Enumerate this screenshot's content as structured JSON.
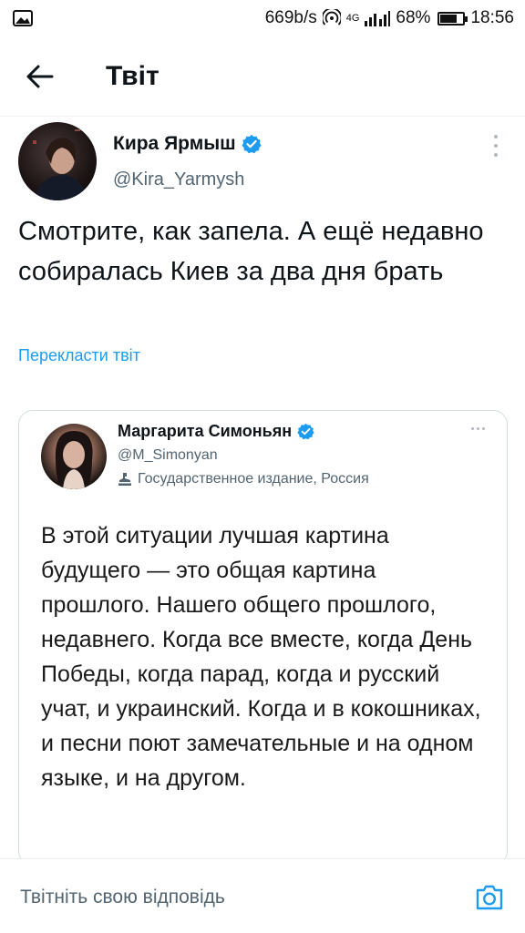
{
  "status_bar": {
    "speed": "669b/s",
    "network": "4G",
    "battery": "68%",
    "battery_level": 0.68,
    "time": "18:56",
    "icons": [
      "image-icon",
      "hotspot-icon",
      "signal-icon",
      "battery-icon"
    ]
  },
  "header": {
    "back_icon": "arrow-left-icon",
    "title": "Твіт"
  },
  "tweet": {
    "author_name": "Кира Ярмыш",
    "author_handle": "@Kira_Yarmysh",
    "verified_icon": "verified-badge-icon",
    "text": "Смотрите, как запела. А ещё недавно собиралась Киев за два дня брать",
    "translate": "Перекласти твіт"
  },
  "quoted_tweet": {
    "author_name": "Маргарита Симоньян",
    "author_handle": "@M_Simonyan",
    "label": "Государственное издание, Россия",
    "label_icon": "state-media-icon",
    "text": "В этой ситуации лучшая картина будущего — это общая картина прошлого. Нашего общего прошлого, недавнего. Когда все вместе, когда День Победы, когда парад, когда и русский учат, и украинский. Когда и в кокошниках, и песни поют замечательные и на одном языке, и на другом."
  },
  "reply": {
    "placeholder": "Твітніть свою відповідь",
    "camera_icon": "camera-icon"
  },
  "colors": {
    "accent": "#1d9bf0",
    "secondary_text": "#536471",
    "border": "#d6dde1"
  }
}
